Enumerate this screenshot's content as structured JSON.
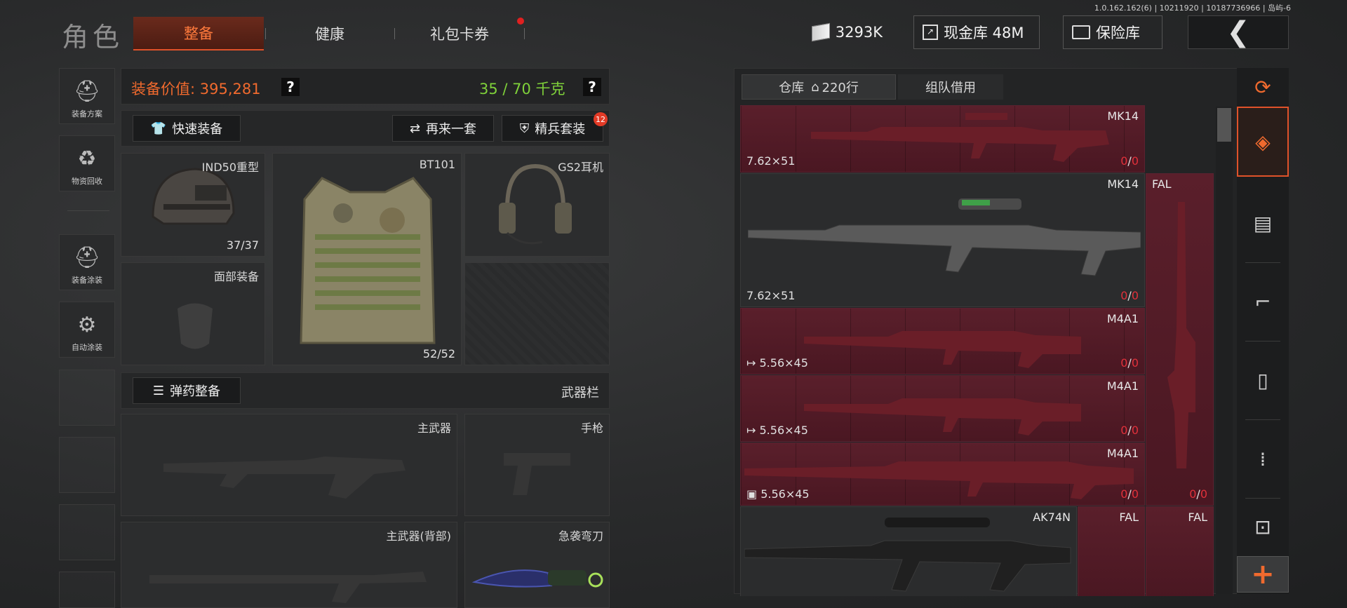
{
  "version": "1.0.162.162(6) | 10211920 | 10187736966 | 岛屿-6",
  "header": {
    "title": "角色",
    "tabs": [
      {
        "label": "整备",
        "active": true
      },
      {
        "label": "健康",
        "active": false
      },
      {
        "label": "礼包卡券",
        "active": false
      }
    ],
    "currency": "3293K",
    "cash_vault": "现金库 48M",
    "safe": "保险库"
  },
  "sidebar": [
    {
      "label": "装备方案",
      "icon": "soldier-plan-icon"
    },
    {
      "label": "物资回收",
      "icon": "recycle-icon"
    },
    {
      "label": "装备涂装",
      "icon": "helmet-paint-icon"
    },
    {
      "label": "自动涂装",
      "icon": "brush-gear-icon"
    }
  ],
  "equip": {
    "value_label": "装备价值: 395,281",
    "weight": "35 / 70 千克",
    "help": "?",
    "quick_equip": "快速装备",
    "again": "再来一套",
    "elite": "精兵套装",
    "elite_badge": "12",
    "helmet": {
      "name": "IND50重型",
      "count": "37/37"
    },
    "armor": {
      "name": "BT101",
      "count": "52/52"
    },
    "headset": {
      "name": "GS2耳机"
    },
    "face": {
      "name": "面部装备"
    },
    "ammo_btn": "弹药整备",
    "weapon_bar": "武器栏",
    "primary": "主武器",
    "pistol": "手枪",
    "primary_back": "主武器(背部)",
    "melee": "急袭弯刀"
  },
  "inventory": {
    "tab_storage": "仓库",
    "tab_rows": "220行",
    "tab_team": "组队借用",
    "items": [
      {
        "name": "MK14",
        "cal": "7.62×51",
        "ammo": "0/0"
      },
      {
        "name": "MK14",
        "cal": "7.62×51",
        "ammo": "0/0"
      },
      {
        "name": "FAL",
        "ammo": "0/0"
      },
      {
        "name": "M4A1",
        "cal": "5.56×45",
        "ammo": "0/0"
      },
      {
        "name": "M4A1",
        "cal": "5.56×45",
        "ammo": "0/0"
      },
      {
        "name": "M4A1",
        "cal": "5.56×45",
        "ammo": "0/0"
      },
      {
        "name": "AK74N"
      },
      {
        "name": "FAL"
      },
      {
        "name": "FAL"
      }
    ]
  },
  "right_icons": [
    "stack-refresh-icon",
    "layer-icon",
    "vest-icon",
    "rifle-icon",
    "magazine-icon",
    "bullet-icon",
    "scope-icon"
  ],
  "plus": "+"
}
